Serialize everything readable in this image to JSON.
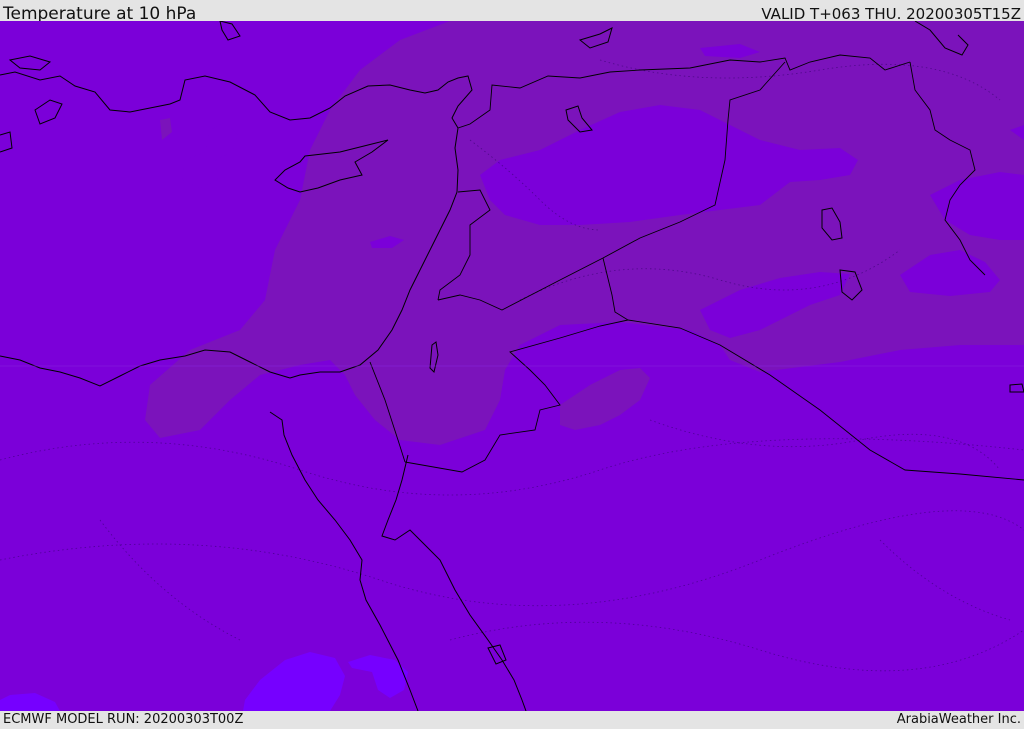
{
  "header": {
    "title": "Temperature at 10 hPa",
    "valid": "VALID T+063 THU. 20200305T15Z"
  },
  "footer": {
    "model_run": "ECMWF MODEL RUN: 20200303T00Z",
    "credit": "ArabiaWeather Inc."
  },
  "colors": {
    "base_field": "#7b00d9",
    "warm_field": "#7b13bb",
    "cold_field": "#7600ff",
    "coastline": "#000000"
  }
}
